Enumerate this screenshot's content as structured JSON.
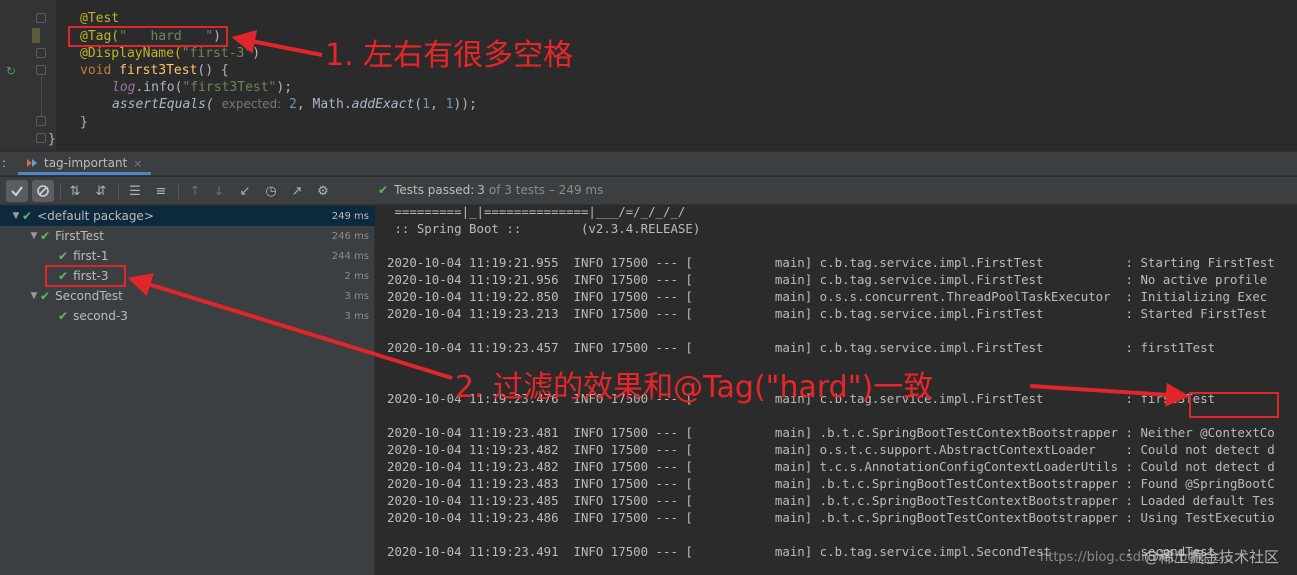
{
  "editor": {
    "lines": {
      "test_ann": "@Test",
      "tag_ann": "@Tag(",
      "tag_str": "\"   hard   \"",
      "tag_close": ")",
      "display_ann": "@DisplayName(",
      "display_str": "\"first-3\"",
      "display_close": ")",
      "void_kw": "void ",
      "method_name": "first3Test",
      "method_rest": "() {",
      "log_obj": "log",
      "log_dot": ".info(",
      "log_str": "\"first3Test\"",
      "log_close": ");",
      "assert_fn": "assertEquals(",
      "assert_hint": "expected:",
      "assert_num": "2",
      "assert_mid": ", Math.",
      "assert_add": "addExact",
      "assert_args_open": "(",
      "assert_arg1": "1",
      "assert_comma": ", ",
      "assert_arg2": "1",
      "assert_end": "));",
      "close1": "}",
      "close2": "}"
    }
  },
  "run_window": {
    "colon": ":",
    "tab_label": "tag-important",
    "tab_close": "×"
  },
  "toolbar": {
    "icons": [
      "check-icon",
      "stop-icon",
      "sort-alpha-icon",
      "sort-duration-icon",
      "expand-all-icon",
      "collapse-all-icon",
      "up-icon",
      "down-icon",
      "import-icon",
      "history-icon",
      "export-icon",
      "settings-icon"
    ],
    "status_prefix": "Tests passed:",
    "status_count": "3",
    "status_suffix": "of 3 tests – 249 ms"
  },
  "tree": [
    {
      "label": "<default package>",
      "duration": "249 ms",
      "level": 0,
      "expanded": true,
      "selected": true
    },
    {
      "label": "FirstTest",
      "duration": "246 ms",
      "level": 1,
      "expanded": true
    },
    {
      "label": "first-1",
      "duration": "244 ms",
      "level": 2
    },
    {
      "label": "first-3",
      "duration": "2 ms",
      "level": 2
    },
    {
      "label": "SecondTest",
      "duration": "3 ms",
      "level": 1,
      "expanded": true
    },
    {
      "label": "second-3",
      "duration": "3 ms",
      "level": 2
    }
  ],
  "console": {
    "lines": [
      " =========|_|==============|___/=/_/_/_/",
      " :: Spring Boot ::        (v2.3.4.RELEASE)",
      "",
      "2020-10-04 11:19:21.955  INFO 17500 --- [           main] c.b.tag.service.impl.FirstTest           : Starting FirstTest",
      "2020-10-04 11:19:21.956  INFO 17500 --- [           main] c.b.tag.service.impl.FirstTest           : No active profile",
      "2020-10-04 11:19:22.850  INFO 17500 --- [           main] o.s.s.concurrent.ThreadPoolTaskExecutor  : Initializing Exec",
      "2020-10-04 11:19:23.213  INFO 17500 --- [           main] c.b.tag.service.impl.FirstTest           : Started FirstTest",
      "",
      "2020-10-04 11:19:23.457  INFO 17500 --- [           main] c.b.tag.service.impl.FirstTest           : first1Test",
      "",
      "",
      "2020-10-04 11:19:23.476  INFO 17500 --- [           main] c.b.tag.service.impl.FirstTest           : first3Test",
      "",
      "2020-10-04 11:19:23.481  INFO 17500 --- [           main] .b.t.c.SpringBootTestContextBootstrapper : Neither @ContextCo",
      "2020-10-04 11:19:23.482  INFO 17500 --- [           main] o.s.t.c.support.AbstractContextLoader    : Could not detect d",
      "2020-10-04 11:19:23.482  INFO 17500 --- [           main] t.c.s.AnnotationConfigContextLoaderUtils : Could not detect d",
      "2020-10-04 11:19:23.483  INFO 17500 --- [           main] .b.t.c.SpringBootTestContextBootstrapper : Found @SpringBootC",
      "2020-10-04 11:19:23.485  INFO 17500 --- [           main] .b.t.c.SpringBootTestContextBootstrapper : Loaded default Tes",
      "2020-10-04 11:19:23.486  INFO 17500 --- [           main] .b.t.c.SpringBootTestContextBootstrapper : Using TestExecutio",
      "",
      "2020-10-04 11:19:23.491  INFO 17500 --- [           main] c.b.tag.service.impl.SecondTest          : secondTest"
    ]
  },
  "annotations": {
    "note1": "1. 左右有很多空格",
    "note2": "2. 过滤的效果和@Tag(\"hard\")一致",
    "color": "#e0262b"
  },
  "watermark": {
    "url": "https://blog.csdn.net/bolg_c...",
    "site": "@稀土掘金技术社区"
  }
}
